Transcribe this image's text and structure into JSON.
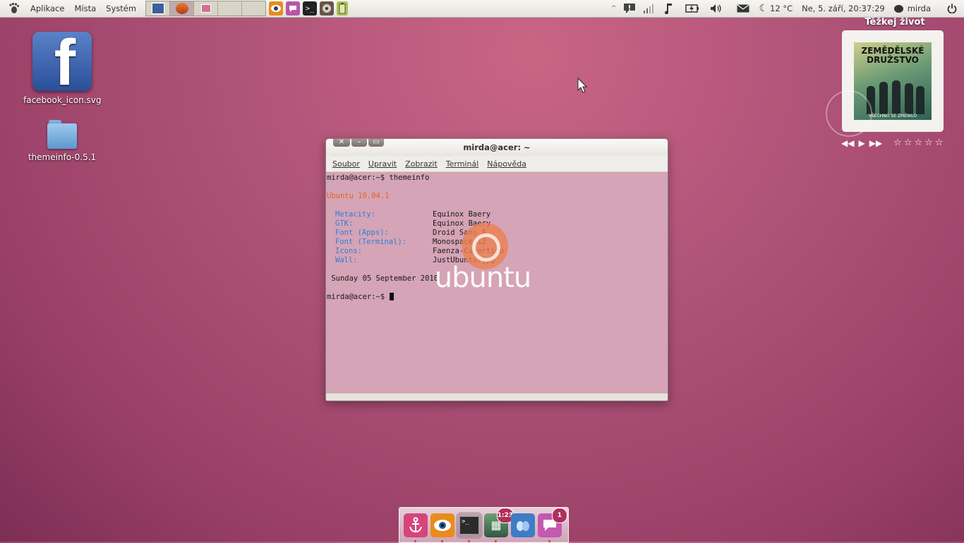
{
  "top_panel": {
    "menus": [
      "Aplikace",
      "Místa",
      "Systém"
    ],
    "tray": {
      "weather": "12 °C",
      "datetime": "Ne,  5. září, 20:37:29",
      "user": "mirda"
    }
  },
  "desktop": {
    "icons": [
      {
        "label": "facebook_icon.svg",
        "icon": "facebook-icon"
      },
      {
        "label": "themeinfo-0.5.1",
        "icon": "folder-icon"
      }
    ]
  },
  "album_widget": {
    "title": "Těžkej život",
    "cover_title_line1": "ZEMĚDĚLSKÉ",
    "cover_title_line2": "DRUŽSTVO",
    "cover_subtitle": "VŠECHNO SE ZMĚNILO",
    "rating_stars": 0,
    "rating_max": 5
  },
  "terminal": {
    "title": "mirda@acer: ~",
    "menu": [
      "Soubor",
      "Upravit",
      "Zobrazit",
      "Terminál",
      "Nápověda"
    ],
    "prompt1": "mirda@acer:~$ themeinfo",
    "distro": "Ubuntu 10.04.1",
    "info": [
      {
        "key": "Metacity:",
        "value": "Equinox Baery"
      },
      {
        "key": "GTK:",
        "value": "Equinox Baery"
      },
      {
        "key": "Font (Apps):",
        "value": "Droid Sans 8"
      },
      {
        "key": "Font (Terminal):",
        "value": "Monospace 12"
      },
      {
        "key": "Icons:",
        "value": "Faenza-Cupertino"
      },
      {
        "key": "Wall:",
        "value": "JustUbuntu.jpg"
      }
    ],
    "date": " Sunday 05 September 2010",
    "prompt2": "mirda@acer:~$ ",
    "watermark": "ubuntu"
  },
  "dock": {
    "items": [
      {
        "icon": "anchor-icon",
        "color": "#d6457a"
      },
      {
        "icon": "eye-of-gnome-icon",
        "color": "#e88c1c"
      },
      {
        "icon": "terminal-icon",
        "color": "#2b2b2b"
      },
      {
        "icon": "image-icon",
        "color": "#3f6b4a",
        "badge": "1:23"
      },
      {
        "icon": "empathy-icon",
        "color": "#3e7cc6"
      },
      {
        "icon": "messaging-icon",
        "color": "#c25ab0",
        "badge": "1"
      }
    ]
  },
  "colors": {
    "wallpaper": "#b2557a",
    "terminal_bg": "#d5a4b6",
    "distro_text": "#e8621f",
    "info_keys": "#2f7fd6"
  }
}
